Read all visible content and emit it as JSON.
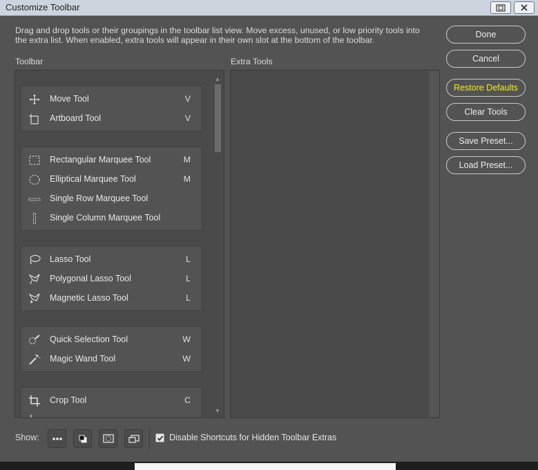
{
  "window": {
    "title": "Customize Toolbar",
    "controls": [
      "restore-icon",
      "close-icon"
    ]
  },
  "instructions": "Drag and drop tools or their groupings in the toolbar list view. Move excess, unused, or low priority tools into the extra list. When enabled, extra tools will appear in their own slot at the bottom of the toolbar.",
  "toolbar_label": "Toolbar",
  "extra_label": "Extra Tools",
  "groups": [
    {
      "tools": [
        {
          "name": "Move Tool",
          "key": "V",
          "icon": "move-icon"
        },
        {
          "name": "Artboard Tool",
          "key": "V",
          "icon": "artboard-icon"
        }
      ]
    },
    {
      "tools": [
        {
          "name": "Rectangular Marquee Tool",
          "key": "M",
          "icon": "rectangular-marquee-icon"
        },
        {
          "name": "Elliptical Marquee Tool",
          "key": "M",
          "icon": "elliptical-marquee-icon"
        },
        {
          "name": "Single Row Marquee Tool",
          "key": "",
          "icon": "single-row-marquee-icon"
        },
        {
          "name": "Single Column Marquee Tool",
          "key": "",
          "icon": "single-column-marquee-icon"
        }
      ]
    },
    {
      "tools": [
        {
          "name": "Lasso Tool",
          "key": "L",
          "icon": "lasso-icon"
        },
        {
          "name": "Polygonal Lasso Tool",
          "key": "L",
          "icon": "polygonal-lasso-icon"
        },
        {
          "name": "Magnetic Lasso Tool",
          "key": "L",
          "icon": "magnetic-lasso-icon"
        }
      ]
    },
    {
      "tools": [
        {
          "name": "Quick Selection Tool",
          "key": "W",
          "icon": "quick-selection-icon"
        },
        {
          "name": "Magic Wand Tool",
          "key": "W",
          "icon": "magic-wand-icon"
        }
      ]
    },
    {
      "tools": [
        {
          "name": "Crop Tool",
          "key": "C",
          "icon": "crop-icon"
        }
      ]
    }
  ],
  "buttons": {
    "done": "Done",
    "cancel": "Cancel",
    "restore_defaults": "Restore Defaults",
    "clear_tools": "Clear Tools",
    "save_preset": "Save Preset...",
    "load_preset": "Load Preset..."
  },
  "show_label": "Show:",
  "show_icons": [
    "more-tools-icon",
    "foreground-background-icon",
    "quick-mask-icon",
    "screen-mode-icon"
  ],
  "disable_shortcuts": {
    "label": "Disable Shortcuts for Hidden Toolbar Extras",
    "checked": true
  },
  "colors": {
    "background": "#535353",
    "highlight_text": "#f2ea2a"
  }
}
